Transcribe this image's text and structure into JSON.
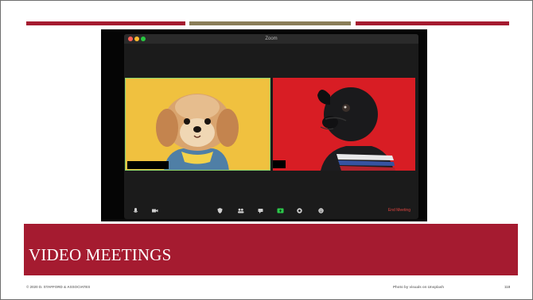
{
  "slide": {
    "title": "VIDEO MEETINGS",
    "copyright": "© 2020 D. STAFFORD & ASSOCIATES",
    "credit": "Photo by visuals on Unsplash",
    "page_number": "118"
  },
  "zoom_window": {
    "title": "Zoom",
    "traffic_lights": [
      "#ff5f57",
      "#febc2e",
      "#28c840"
    ],
    "toolbar_icons": [
      "microphone-icon",
      "video-camera-icon",
      "security-icon",
      "participants-icon",
      "chat-icon",
      "share-screen-icon",
      "record-icon",
      "reactions-icon"
    ],
    "end_meeting_label": "End Meeting",
    "participants": [
      {
        "tile_color": "#f0c13f",
        "subject": "dog-shih-tzu"
      },
      {
        "tile_color": "#d81d24",
        "subject": "dog-pug"
      }
    ]
  },
  "colors": {
    "accent": "#a51b30",
    "gold": "#8a7d58",
    "active_speaker_border": "#8bd46a",
    "end_meeting": "#e0443f"
  }
}
